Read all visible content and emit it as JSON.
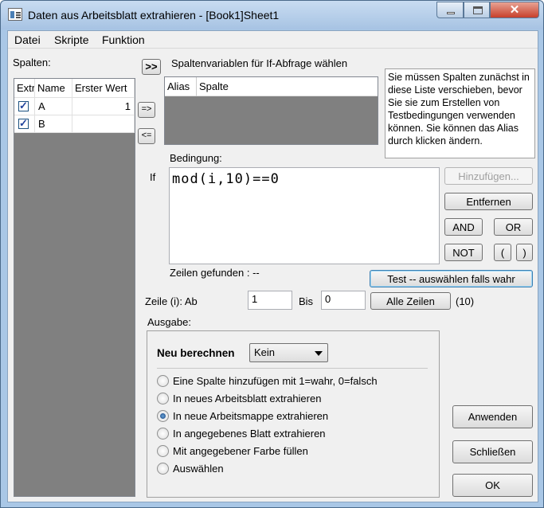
{
  "window": {
    "title": "Daten aus Arbeitsblatt extrahieren - [Book1]Sheet1"
  },
  "menu": [
    "Datei",
    "Skripte",
    "Funktion"
  ],
  "columns_panel": {
    "label": "Spalten:",
    "headers": [
      "Extr",
      "Name",
      "Erster Wert"
    ],
    "rows": [
      {
        "checked": true,
        "name": "A",
        "first_value": "1"
      },
      {
        "checked": true,
        "name": "B",
        "first_value": ""
      }
    ]
  },
  "move_buttons": {
    "forward_all": ">>",
    "forward": "=>",
    "back": "<="
  },
  "variables": {
    "label": "Spaltenvariablen für If-Abfrage wählen",
    "headers": [
      "Alias",
      "Spalte"
    ]
  },
  "info_text": "Sie müssen Spalten zunächst in diese Liste verschieben, bevor Sie sie zum Erstellen von Testbedingungen verwenden können. Sie können das Alias durch klicken ändern.",
  "condition": {
    "label": "Bedingung:",
    "if_label": "If",
    "value": "mod(i,10)==0"
  },
  "condition_buttons": {
    "add": "Hinzufügen...",
    "remove": "Entfernen",
    "and": "AND",
    "or": "OR",
    "not": "NOT",
    "lparen": "(",
    "rparen": ")"
  },
  "rows_found": "Zeilen gefunden : --",
  "test_button": "Test -- auswählen falls wahr",
  "row_range": {
    "label": "Zeile (i): Ab",
    "from": "1",
    "to_label": "Bis",
    "to": "0",
    "all_rows": "Alle Zeilen",
    "count": "(10)"
  },
  "output": {
    "label": "Ausgabe:",
    "recalc_label": "Neu berechnen",
    "recalc_value": "Kein",
    "options": [
      {
        "label": "Eine Spalte hinzufügen mit 1=wahr, 0=falsch",
        "selected": false
      },
      {
        "label": "In neues Arbeitsblatt extrahieren",
        "selected": false
      },
      {
        "label": "In neue Arbeitsmappe extrahieren",
        "selected": true
      },
      {
        "label": "In angegebenes Blatt extrahieren",
        "selected": false
      },
      {
        "label": "Mit angegebener Farbe füllen",
        "selected": false
      },
      {
        "label": "Auswählen",
        "selected": false
      }
    ]
  },
  "actions": {
    "apply": "Anwenden",
    "close": "Schließen",
    "ok": "OK"
  }
}
